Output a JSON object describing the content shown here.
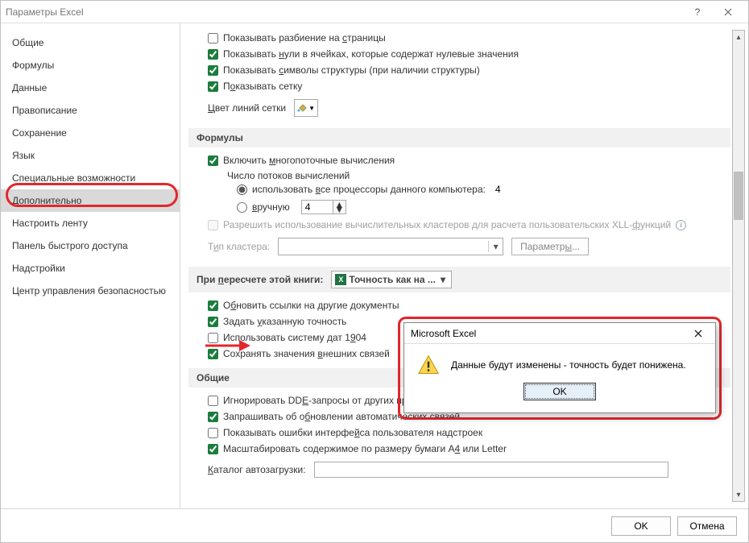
{
  "window": {
    "title": "Параметры Excel"
  },
  "sidebar": {
    "items": [
      "Общие",
      "Формулы",
      "Данные",
      "Правописание",
      "Сохранение",
      "Язык",
      "Специальные возможности",
      "Дополнительно",
      "Настроить ленту",
      "Панель быстрого доступа",
      "Надстройки",
      "Центр управления безопасностью"
    ],
    "active_index": 7
  },
  "display": {
    "checks": [
      {
        "label_pre": "Показывать разбиение на ",
        "u": "с",
        "label_post": "траницы",
        "checked": false
      },
      {
        "label_pre": "Показывать ",
        "u": "н",
        "label_post": "ули в ячейках, которые содержат нулевые значения",
        "checked": true
      },
      {
        "label_pre": "Показывать ",
        "u": "с",
        "label_post": "имволы структуры (при наличии структуры)",
        "checked": true
      },
      {
        "label_pre": "П",
        "u": "о",
        "label_post": "казывать сетку",
        "checked": true
      }
    ],
    "grid_color_label_pre": "",
    "grid_color_u": "Ц",
    "grid_color_label_post": "вет линий сетки"
  },
  "formulas": {
    "header": "Формулы",
    "multithread_pre": "Включить ",
    "multithread_u": "м",
    "multithread_post": "ногопоточные вычисления",
    "multithread_checked": true,
    "threads_label": "Число потоков вычислений",
    "radio_auto_pre": "использовать ",
    "radio_auto_u": "в",
    "radio_auto_post": "се процессоры данного компьютера:",
    "cpu_count": "4",
    "radio_manual_u": "в",
    "radio_manual_post": "ручную",
    "manual_value": "4",
    "xll_pre": "Разрешить использование вычислительных кластеров для расчета пользовательских XLL-",
    "xll_u": "ф",
    "xll_post": "ункций",
    "cluster_type_pre": "Т",
    "cluster_type_u": "и",
    "cluster_type_post": "п кластера:",
    "cluster_params_btn_pre": "Параметр",
    "cluster_params_btn_u": "ы",
    "cluster_params_btn_post": "..."
  },
  "recalc": {
    "header_pre": "При ",
    "header_u": "п",
    "header_post": "ересчете этой книги:",
    "workbook": "Точность как на ...",
    "checks": [
      {
        "pre": "О",
        "u": "б",
        "post": "новить ссылки на другие документы",
        "checked": true
      },
      {
        "pre": "Задать ",
        "u": "у",
        "post": "казанную точность",
        "checked": true
      },
      {
        "pre": "Использовать систему дат 1",
        "u": "9",
        "post": "04",
        "checked": false
      },
      {
        "pre": "Сохранять значения ",
        "u": "в",
        "post": "нешних связей",
        "checked": true
      }
    ]
  },
  "general": {
    "header": "Общие",
    "checks": [
      {
        "pre": "Игнорировать DD",
        "u": "E",
        "post": "-запросы от других приложений",
        "checked": false
      },
      {
        "pre": "Запрашивать об о",
        "u": "б",
        "post": "новлении автоматических связей",
        "checked": true
      },
      {
        "pre": "Показывать ошибки интерфе",
        "u": "й",
        "post": "са пользователя надстроек",
        "checked": false
      },
      {
        "pre": "Масштабировать содержимое по размеру бумаги A",
        "u": "4",
        "post": " или Letter",
        "checked": true
      }
    ],
    "autostart_pre": "",
    "autostart_u": "К",
    "autostart_post": "аталог автозагрузки:",
    "autostart_value": ""
  },
  "footer": {
    "ok": "OK",
    "cancel": "Отмена"
  },
  "msgbox": {
    "title": "Microsoft Excel",
    "text": "Данные будут изменены - точность будет понижена.",
    "ok": "OK"
  }
}
